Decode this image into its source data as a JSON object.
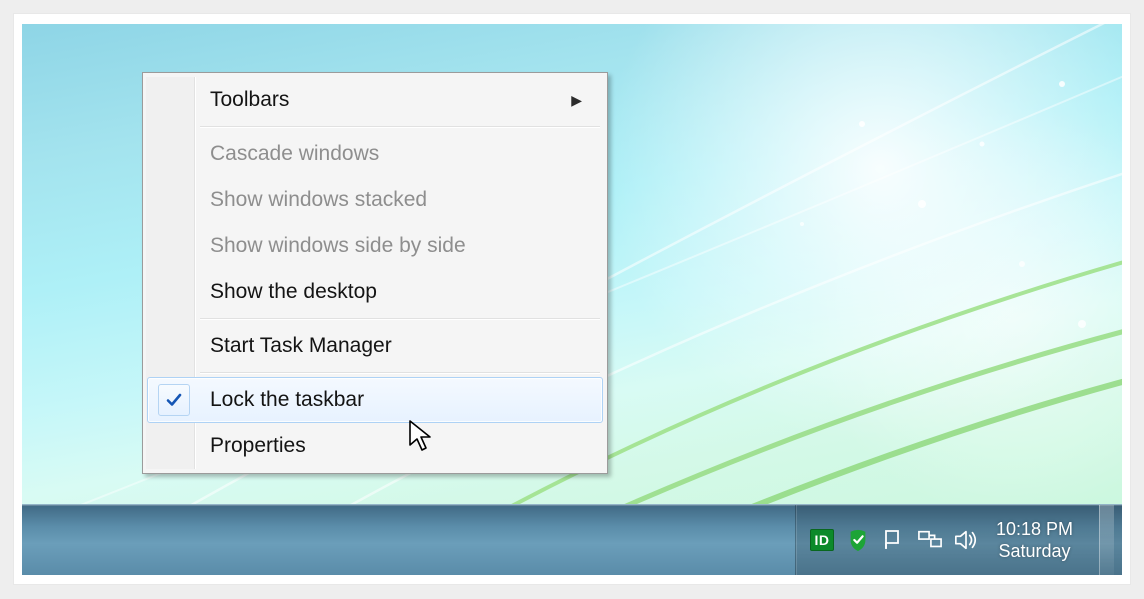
{
  "context_menu": {
    "items": [
      {
        "label": "Toolbars",
        "disabled": false,
        "submenu": true
      },
      {
        "separator": true
      },
      {
        "label": "Cascade windows",
        "disabled": true
      },
      {
        "label": "Show windows stacked",
        "disabled": true
      },
      {
        "label": "Show windows side by side",
        "disabled": true
      },
      {
        "label": "Show the desktop",
        "disabled": false
      },
      {
        "separator": true
      },
      {
        "label": "Start Task Manager",
        "disabled": false
      },
      {
        "separator": true
      },
      {
        "label": "Lock the taskbar",
        "disabled": false,
        "checked": true,
        "highlight": true
      },
      {
        "label": "Properties",
        "disabled": false
      }
    ]
  },
  "tray": {
    "id_badge": "ID",
    "clock_time": "10:18 PM",
    "clock_day": "Saturday"
  }
}
